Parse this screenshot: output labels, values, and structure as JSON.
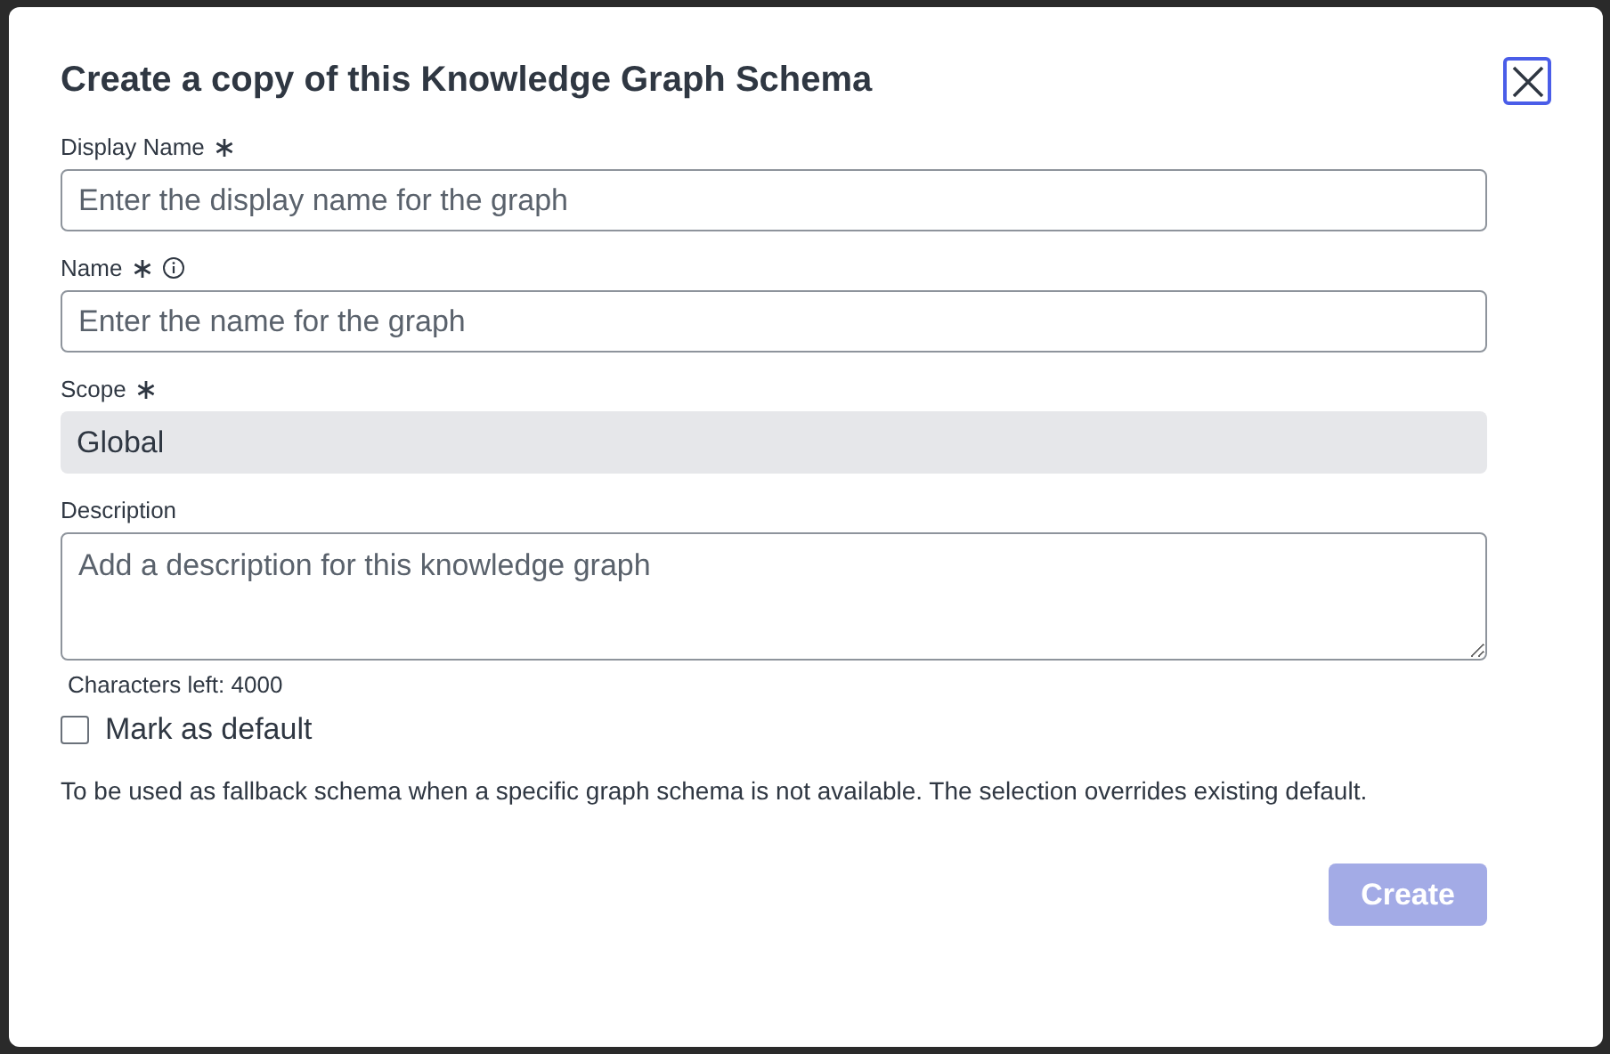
{
  "dialog": {
    "title": "Create a copy of this Knowledge Graph Schema"
  },
  "fields": [
    {
      "kind": "input",
      "label": "Display Name",
      "required": true,
      "info": false,
      "placeholder": "Enter the display name for the graph"
    },
    {
      "kind": "input",
      "label": "Name",
      "required": true,
      "info": true,
      "placeholder": "Enter the name for the graph"
    },
    {
      "kind": "readonly",
      "label": "Scope",
      "required": true,
      "info": false,
      "value": "Global"
    },
    {
      "kind": "textarea",
      "label": "Description",
      "required": false,
      "info": false,
      "placeholder": "Add a description for this knowledge graph",
      "hint": "Characters left: 4000"
    }
  ],
  "default_option": {
    "label": "Mark as default",
    "checked": false
  },
  "note": "To be used as fallback schema when a specific graph schema is not available. The selection overrides existing default.",
  "buttons": [
    {
      "label": "Create",
      "disabled": true
    }
  ]
}
